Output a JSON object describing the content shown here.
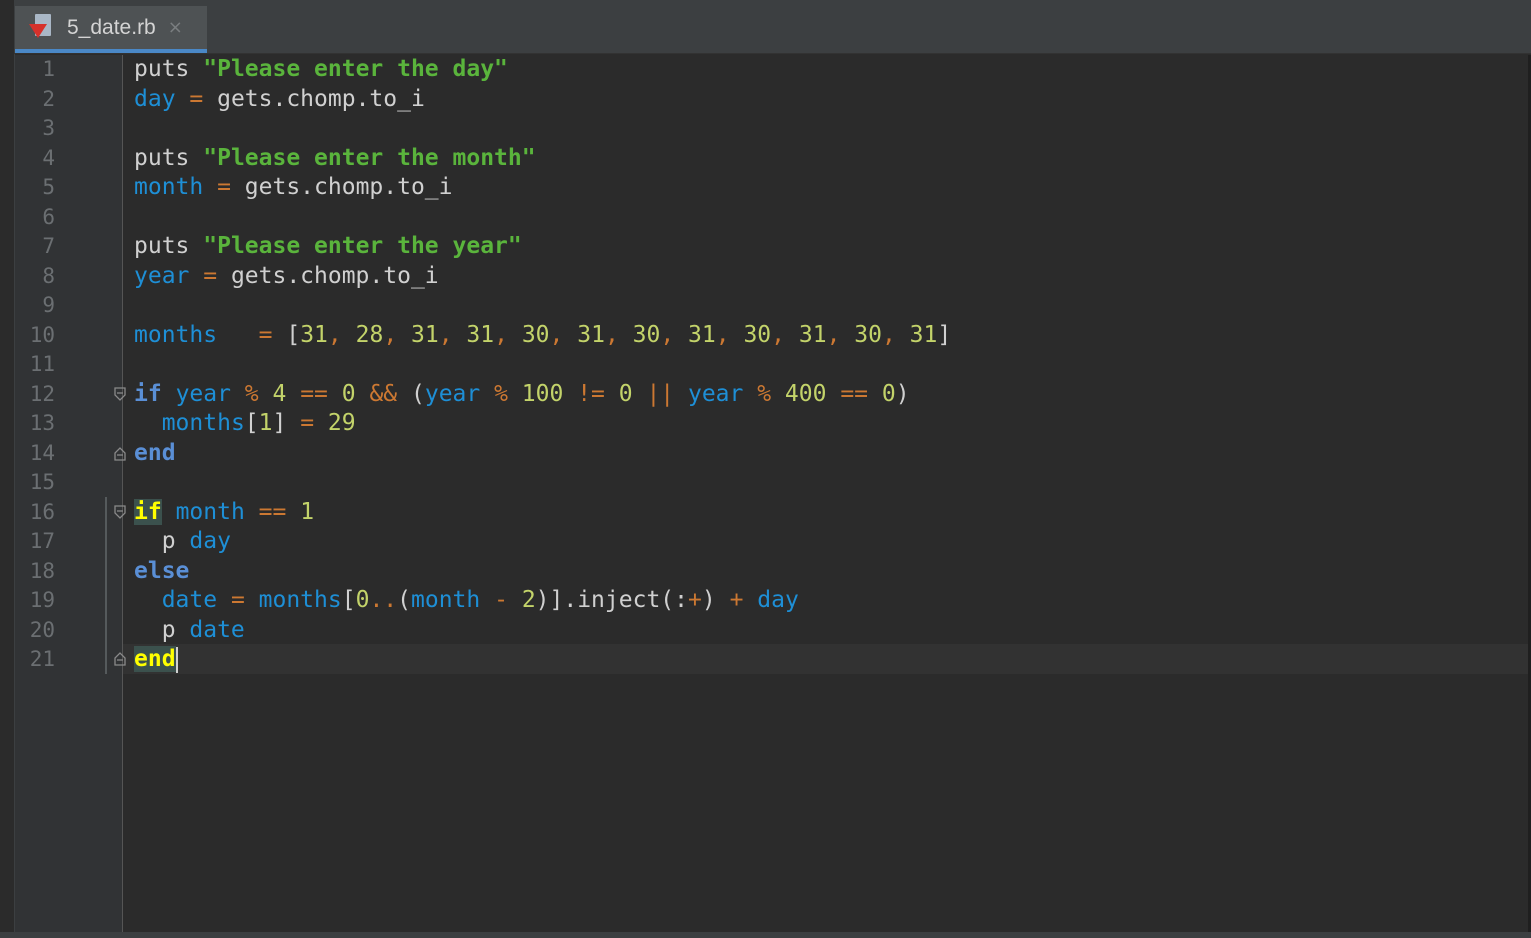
{
  "tab": {
    "filename": "5_date.rb",
    "close_glyph": "×",
    "icon": "ruby-file-icon"
  },
  "line_numbers": [
    "1",
    "2",
    "3",
    "4",
    "5",
    "6",
    "7",
    "8",
    "9",
    "10",
    "11",
    "12",
    "13",
    "14",
    "15",
    "16",
    "17",
    "18",
    "19",
    "20",
    "21"
  ],
  "code_lines": [
    [
      {
        "t": "pl",
        "v": "puts "
      },
      {
        "t": "str",
        "v": "\"Please enter the day\""
      }
    ],
    [
      {
        "t": "var",
        "v": "day"
      },
      {
        "t": "op",
        "v": " = "
      },
      {
        "t": "pl",
        "v": "gets.chomp.to_i"
      }
    ],
    [],
    [
      {
        "t": "pl",
        "v": "puts "
      },
      {
        "t": "str",
        "v": "\"Please enter the month\""
      }
    ],
    [
      {
        "t": "var",
        "v": "month"
      },
      {
        "t": "op",
        "v": " = "
      },
      {
        "t": "pl",
        "v": "gets.chomp.to_i"
      }
    ],
    [],
    [
      {
        "t": "pl",
        "v": "puts "
      },
      {
        "t": "str",
        "v": "\"Please enter the year\""
      }
    ],
    [
      {
        "t": "var",
        "v": "year"
      },
      {
        "t": "op",
        "v": " = "
      },
      {
        "t": "pl",
        "v": "gets.chomp.to_i"
      }
    ],
    [],
    [
      {
        "t": "var",
        "v": "months"
      },
      {
        "t": "op",
        "v": "   = "
      },
      {
        "t": "pl",
        "v": "["
      },
      {
        "t": "num",
        "v": "31"
      },
      {
        "t": "op",
        "v": ", "
      },
      {
        "t": "num",
        "v": "28"
      },
      {
        "t": "op",
        "v": ", "
      },
      {
        "t": "num",
        "v": "31"
      },
      {
        "t": "op",
        "v": ", "
      },
      {
        "t": "num",
        "v": "31"
      },
      {
        "t": "op",
        "v": ", "
      },
      {
        "t": "num",
        "v": "30"
      },
      {
        "t": "op",
        "v": ", "
      },
      {
        "t": "num",
        "v": "31"
      },
      {
        "t": "op",
        "v": ", "
      },
      {
        "t": "num",
        "v": "30"
      },
      {
        "t": "op",
        "v": ", "
      },
      {
        "t": "num",
        "v": "31"
      },
      {
        "t": "op",
        "v": ", "
      },
      {
        "t": "num",
        "v": "30"
      },
      {
        "t": "op",
        "v": ", "
      },
      {
        "t": "num",
        "v": "31"
      },
      {
        "t": "op",
        "v": ", "
      },
      {
        "t": "num",
        "v": "30"
      },
      {
        "t": "op",
        "v": ", "
      },
      {
        "t": "num",
        "v": "31"
      },
      {
        "t": "pl",
        "v": "]"
      }
    ],
    [],
    [
      {
        "t": "kw",
        "v": "if"
      },
      {
        "t": "pl",
        "v": " "
      },
      {
        "t": "var",
        "v": "year"
      },
      {
        "t": "op",
        "v": " % "
      },
      {
        "t": "num",
        "v": "4"
      },
      {
        "t": "op",
        "v": " == "
      },
      {
        "t": "num",
        "v": "0"
      },
      {
        "t": "op",
        "v": " && "
      },
      {
        "t": "pl",
        "v": "("
      },
      {
        "t": "var",
        "v": "year"
      },
      {
        "t": "op",
        "v": " % "
      },
      {
        "t": "num",
        "v": "100"
      },
      {
        "t": "op",
        "v": " != "
      },
      {
        "t": "num",
        "v": "0"
      },
      {
        "t": "op",
        "v": " || "
      },
      {
        "t": "var",
        "v": "year"
      },
      {
        "t": "op",
        "v": " % "
      },
      {
        "t": "num",
        "v": "400"
      },
      {
        "t": "op",
        "v": " == "
      },
      {
        "t": "num",
        "v": "0"
      },
      {
        "t": "pl",
        "v": ")"
      }
    ],
    [
      {
        "t": "pl",
        "v": "  "
      },
      {
        "t": "var",
        "v": "months"
      },
      {
        "t": "pl",
        "v": "["
      },
      {
        "t": "num",
        "v": "1"
      },
      {
        "t": "pl",
        "v": "]"
      },
      {
        "t": "op",
        "v": " = "
      },
      {
        "t": "num",
        "v": "29"
      }
    ],
    [
      {
        "t": "kw",
        "v": "end"
      }
    ],
    [],
    [
      {
        "t": "kw-hl",
        "v": "if"
      },
      {
        "t": "pl",
        "v": " "
      },
      {
        "t": "var",
        "v": "month"
      },
      {
        "t": "op",
        "v": " == "
      },
      {
        "t": "num",
        "v": "1"
      }
    ],
    [
      {
        "t": "pl",
        "v": "  p "
      },
      {
        "t": "var",
        "v": "day"
      }
    ],
    [
      {
        "t": "kw",
        "v": "else"
      }
    ],
    [
      {
        "t": "pl",
        "v": "  "
      },
      {
        "t": "var",
        "v": "date"
      },
      {
        "t": "op",
        "v": " = "
      },
      {
        "t": "var",
        "v": "months"
      },
      {
        "t": "pl",
        "v": "["
      },
      {
        "t": "num",
        "v": "0"
      },
      {
        "t": "op",
        "v": ".."
      },
      {
        "t": "pl",
        "v": "("
      },
      {
        "t": "var",
        "v": "month"
      },
      {
        "t": "op",
        "v": " - "
      },
      {
        "t": "num",
        "v": "2"
      },
      {
        "t": "pl",
        "v": ")].inject(:"
      },
      {
        "t": "op",
        "v": "+"
      },
      {
        "t": "pl",
        "v": ")"
      },
      {
        "t": "op",
        "v": " + "
      },
      {
        "t": "var",
        "v": "day"
      }
    ],
    [
      {
        "t": "pl",
        "v": "  p "
      },
      {
        "t": "var",
        "v": "date"
      }
    ],
    [
      {
        "t": "kw-hl",
        "v": "end"
      }
    ]
  ],
  "colors": {
    "background": "#2b2b2b",
    "keyword": "#5a8fd6",
    "string": "#5ab43c",
    "variable": "#1e8fd6",
    "operator": "#cc7832",
    "number": "#c3d36a",
    "matched_keyword": "#ffff00",
    "tab_underline": "#4a88c7"
  }
}
